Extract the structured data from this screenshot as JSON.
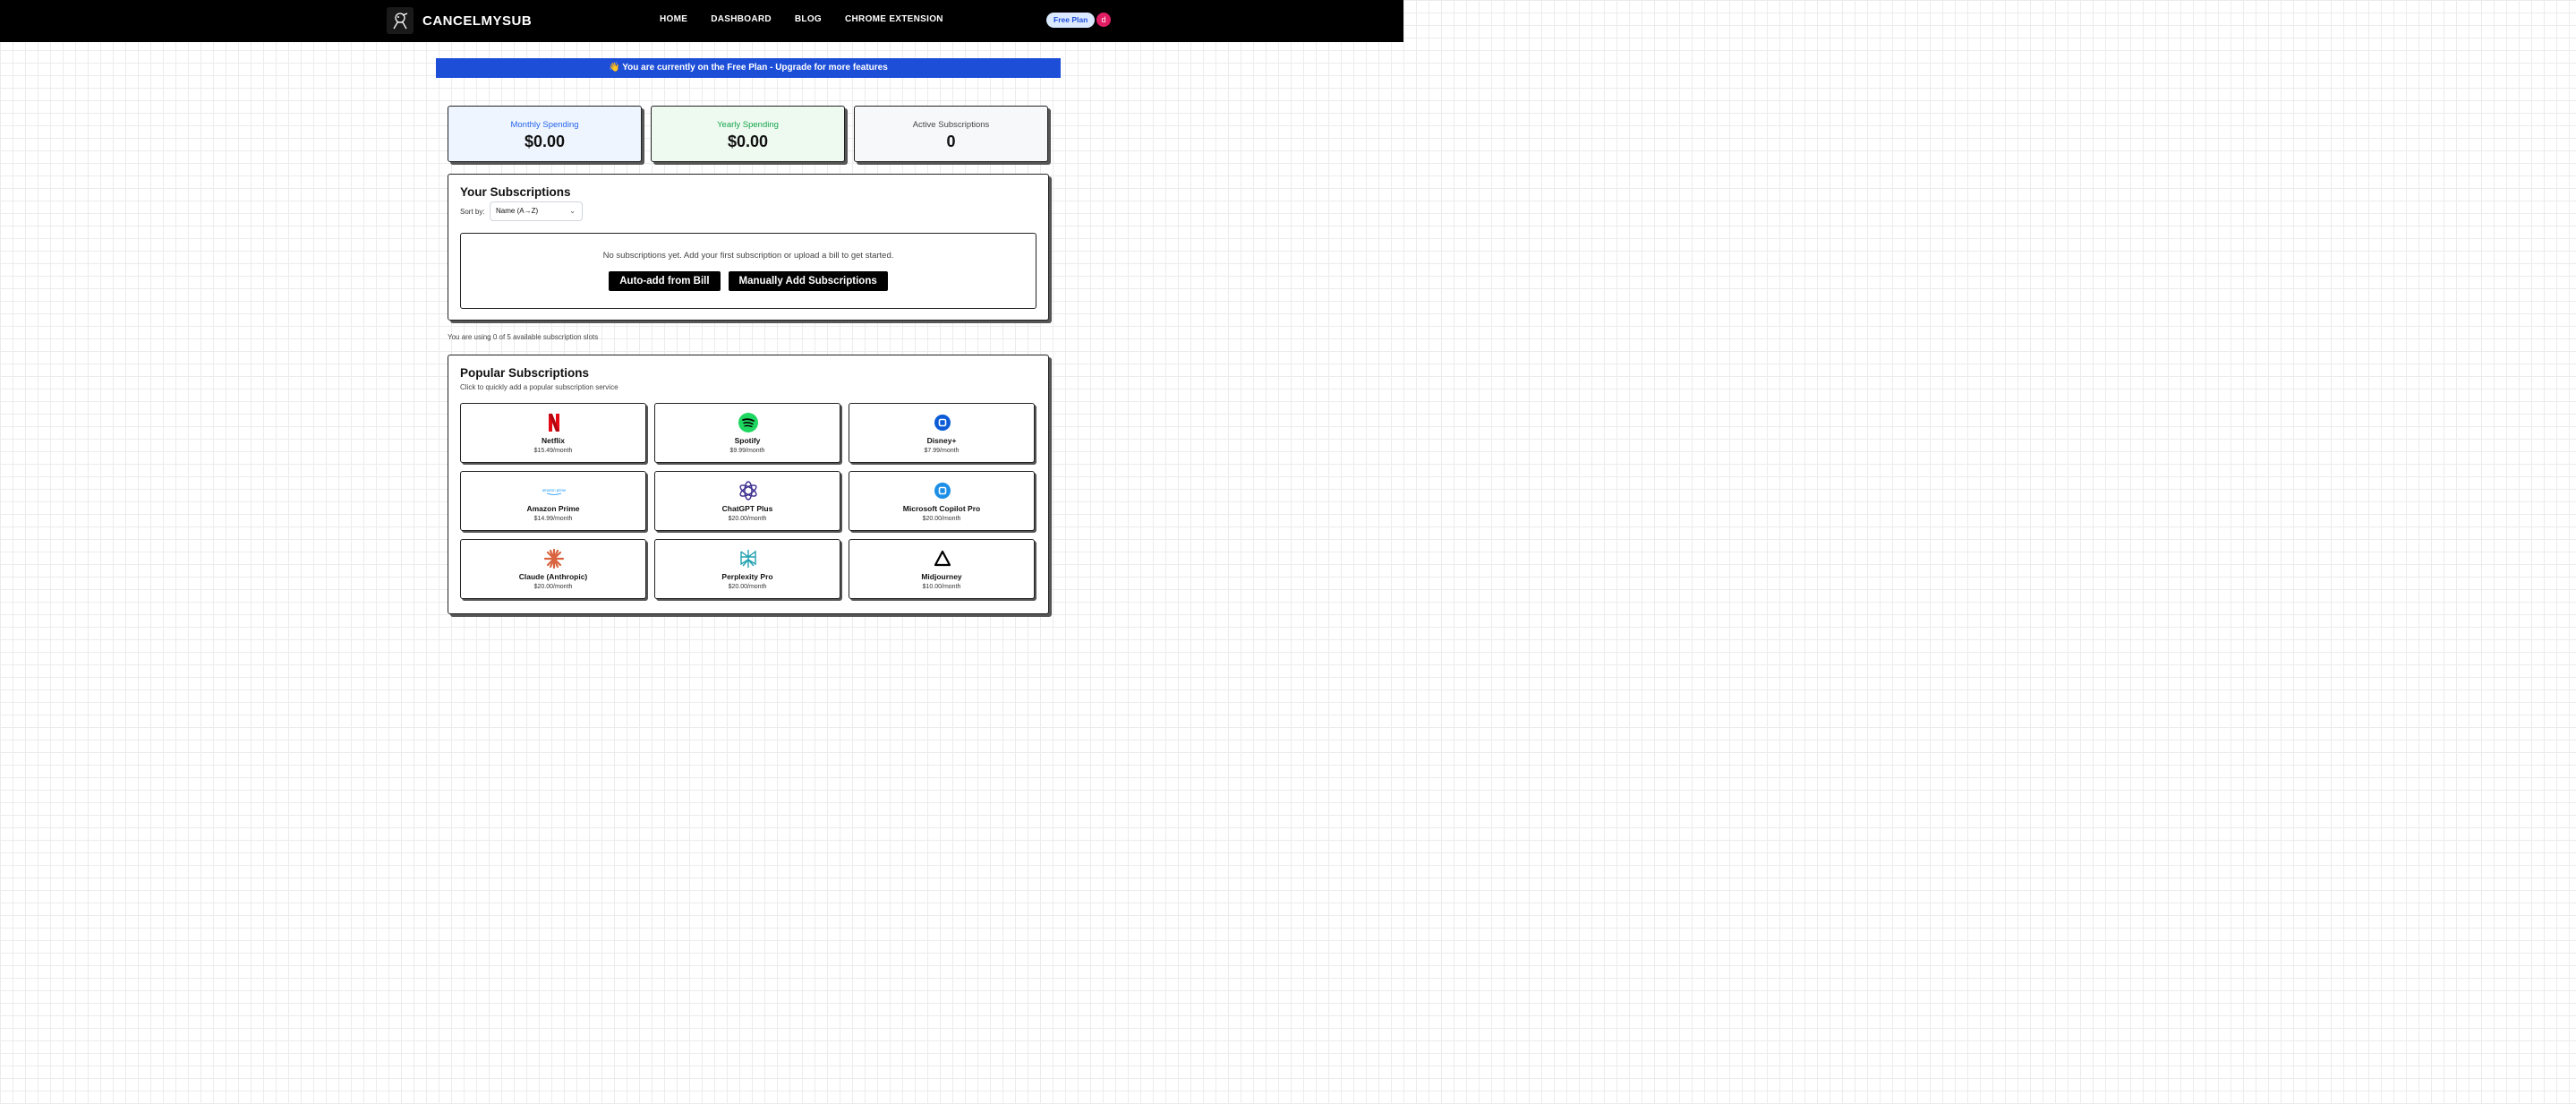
{
  "app": {
    "brand": "CANCELMYSUB"
  },
  "nav": {
    "items": [
      {
        "label": "HOME"
      },
      {
        "label": "DASHBOARD"
      },
      {
        "label": "BLOG"
      },
      {
        "label": "CHROME EXTENSION"
      }
    ],
    "plan_badge": "Free Plan",
    "avatar_initial": "d"
  },
  "banner": {
    "text": "👋 You are currently on the Free Plan - Upgrade for more features"
  },
  "stats": {
    "monthly": {
      "label": "Monthly Spending",
      "value": "$0.00"
    },
    "yearly": {
      "label": "Yearly Spending",
      "value": "$0.00"
    },
    "active": {
      "label": "Active Subscriptions",
      "value": "0"
    }
  },
  "subscriptions": {
    "title": "Your Subscriptions",
    "sort_label": "Sort by:",
    "sort_value": "Name (A→Z)",
    "empty_text": "No subscriptions yet. Add your first subscription or upload a bill to get started.",
    "auto_add_label": "Auto-add from Bill",
    "manual_add_label": "Manually Add Subscriptions",
    "slots_note": "You are using 0 of 5 available subscription slots"
  },
  "popular": {
    "title": "Popular Subscriptions",
    "subtitle": "Click to quickly add a popular subscription service",
    "items": [
      {
        "name": "Netflix",
        "price": "$15.49/month",
        "icon": "netflix-icon"
      },
      {
        "name": "Spotify",
        "price": "$9.99/month",
        "icon": "spotify-icon"
      },
      {
        "name": "Disney+",
        "price": "$7.99/month",
        "icon": "disney-plus-icon"
      },
      {
        "name": "Amazon Prime",
        "price": "$14.99/month",
        "icon": "amazon-prime-icon",
        "icon_text": "amazon prime"
      },
      {
        "name": "ChatGPT Plus",
        "price": "$20.00/month",
        "icon": "chatgpt-icon"
      },
      {
        "name": "Microsoft Copilot Pro",
        "price": "$20.00/month",
        "icon": "copilot-icon"
      },
      {
        "name": "Claude (Anthropic)",
        "price": "$20.00/month",
        "icon": "claude-icon"
      },
      {
        "name": "Perplexity Pro",
        "price": "$20.00/month",
        "icon": "perplexity-icon"
      },
      {
        "name": "Midjourney",
        "price": "$10.00/month",
        "icon": "midjourney-icon"
      }
    ]
  },
  "colors": {
    "banner": "#1d4ed8",
    "monthly_accent": "#2563eb",
    "yearly_accent": "#16a34a",
    "avatar": "#e11d63"
  }
}
